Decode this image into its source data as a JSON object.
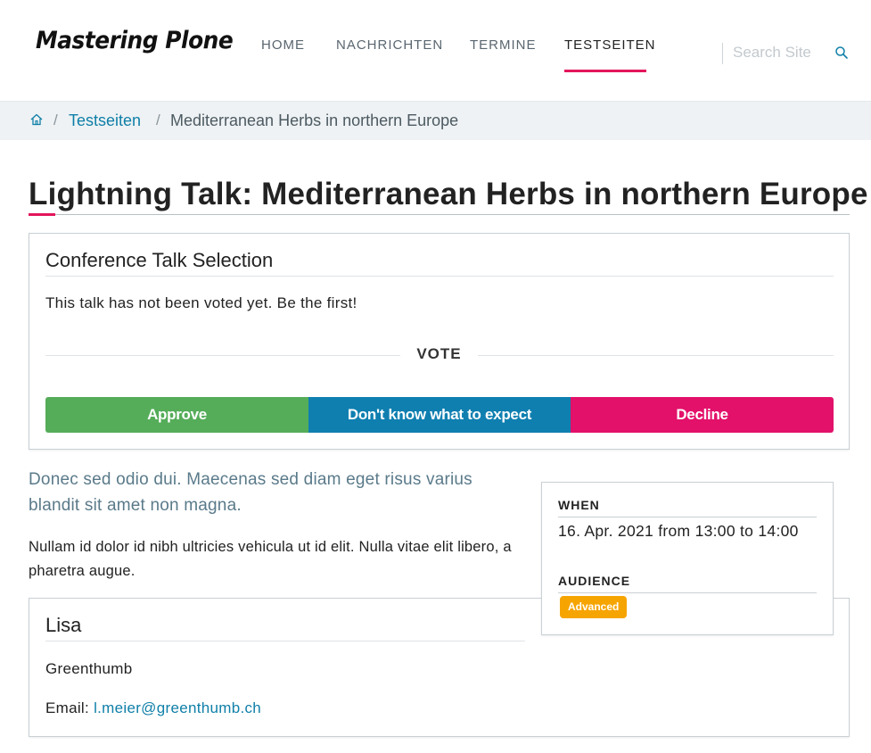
{
  "site": {
    "logo": "Mastering Plone"
  },
  "nav": {
    "items": [
      "HOME",
      "NACHRICHTEN",
      "TERMINE",
      "TESTSEITEN"
    ],
    "active": "TESTSEITEN"
  },
  "search": {
    "placeholder": "Search Site",
    "icon": "search-icon"
  },
  "breadcrumb": {
    "home_icon": "home-icon",
    "separator": "/",
    "items": [
      "Testseiten",
      "Mediterranean Herbs in northern Europe"
    ]
  },
  "page": {
    "title": "Lightning Talk: Mediterranean Herbs in northern Europe"
  },
  "vote": {
    "heading": "Conference Talk Selection",
    "status": "This talk has not been voted yet. Be the first!",
    "label": "VOTE",
    "buttons": {
      "approve": "Approve",
      "unknown": "Don't know what to expect",
      "decline": "Decline"
    },
    "colors": {
      "approve": "#55ad59",
      "unknown": "#0f7fb0",
      "decline": "#e3116a"
    }
  },
  "content": {
    "lead": "Donec sed odio dui. Maecenas sed diam eget risus varius blandit sit amet non magna.",
    "body": "Nullam id dolor id nibh ultricies vehicula ut id elit. Nulla vitae elit libero, a pharetra augue."
  },
  "info": {
    "when_label": "WHEN",
    "when_value": "16. Apr. 2021 from 13:00 to 14:00",
    "audience_label": "AUDIENCE",
    "audience_badge": "Advanced",
    "badge_color": "#f6a400"
  },
  "speaker": {
    "name": "Lisa",
    "organisation": "Greenthumb",
    "email_label": "Email:",
    "email": "l.meier@greenthumb.ch"
  },
  "theme": {
    "accent": "#e3165b",
    "link": "#0f7fa8"
  }
}
